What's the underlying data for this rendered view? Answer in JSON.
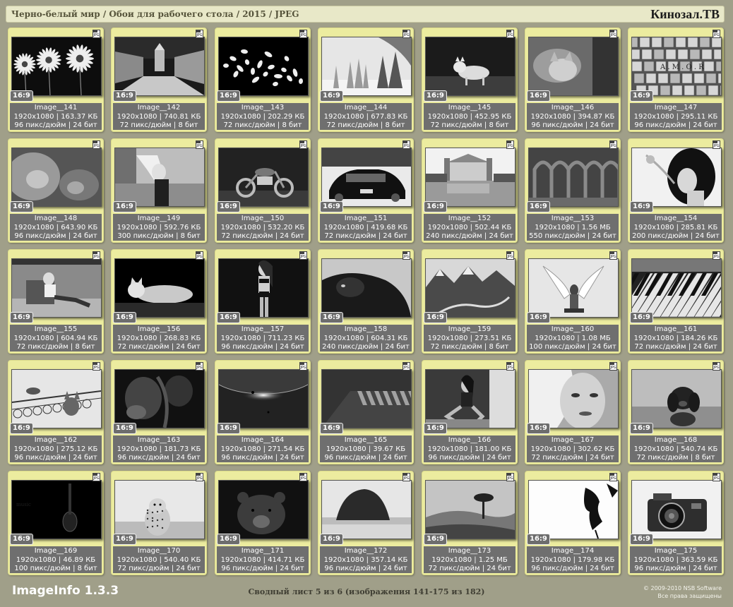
{
  "header": {
    "path": "Черно-белый мир / Обои для рабочего стола / 2015 / JPEG",
    "brand": "Кинозал.ТВ"
  },
  "icons": {
    "format_badge": "jpeg-file-icon",
    "format_text": "JPG"
  },
  "colors": {
    "background": "#a09f89",
    "card": "#ecec9f",
    "info": "#6f6f6f",
    "header": "#e8e8c8"
  },
  "images": [
    {
      "name": "Image__141",
      "res": "1920x1080 | 163.37 КБ",
      "meta": "96 пикс/дюйм | 24 бит",
      "ratio": "16:9",
      "subject": "daisies"
    },
    {
      "name": "Image__142",
      "res": "1920x1080 | 740.81 КБ",
      "meta": "72 пикс/дюйм | 8 бит",
      "ratio": "16:9",
      "subject": "palace-street"
    },
    {
      "name": "Image__143",
      "res": "1920x1080 | 202.29 КБ",
      "meta": "72 пикс/дюйм | 8 бит",
      "ratio": "16:9",
      "subject": "falling-discs"
    },
    {
      "name": "Image__144",
      "res": "1920x1080 | 677.83 КБ",
      "meta": "72 пикс/дюйм | 8 бит",
      "ratio": "16:9",
      "subject": "snowy-forest"
    },
    {
      "name": "Image__145",
      "res": "1920x1080 | 452.95 КБ",
      "meta": "72 пикс/дюйм | 8 бит",
      "ratio": "16:9",
      "subject": "wolf"
    },
    {
      "name": "Image__146",
      "res": "1920x1080 | 394.87 КБ",
      "meta": "96 пикс/дюйм | 24 бит",
      "ratio": "16:9",
      "subject": "kitten"
    },
    {
      "name": "Image__147",
      "res": "1920x1080 | 295.11 КБ",
      "meta": "96 пикс/дюйм | 24 бит",
      "ratio": "16:9",
      "subject": "letter-tiles"
    },
    {
      "name": "Image__148",
      "res": "1920x1080 | 643.90 КБ",
      "meta": "96 пикс/дюйм | 24 бит",
      "ratio": "16:9",
      "subject": "lions"
    },
    {
      "name": "Image__149",
      "res": "1920x1080 | 592.76 КБ",
      "meta": "300 пикс/дюйм | 8 бит",
      "ratio": "16:9",
      "subject": "blonde-girl"
    },
    {
      "name": "Image__150",
      "res": "1920x1080 | 532.20 КБ",
      "meta": "72 пикс/дюйм | 24 бит",
      "ratio": "16:9",
      "subject": "motorcycle"
    },
    {
      "name": "Image__151",
      "res": "1920x1080 | 419.68 КБ",
      "meta": "72 пикс/дюйм | 24 бит",
      "ratio": "16:9",
      "subject": "sports-car"
    },
    {
      "name": "Image__152",
      "res": "1920x1080 | 502.44 КБ",
      "meta": "240 пикс/дюйм | 24 бит",
      "ratio": "16:9",
      "subject": "castle-lake"
    },
    {
      "name": "Image__153",
      "res": "1920x1080 | 1.56 МБ",
      "meta": "550 пикс/дюйм | 24 бит",
      "ratio": "16:9",
      "subject": "ruins"
    },
    {
      "name": "Image__154",
      "res": "1920x1080 | 285.81 КБ",
      "meta": "200 пикс/дюйм | 24 бит",
      "ratio": "16:9",
      "subject": "smoking-woman"
    },
    {
      "name": "Image__155",
      "res": "1920x1080 | 604.94 КБ",
      "meta": "72 пикс/дюйм | 8 бит",
      "ratio": "16:9",
      "subject": "man-chair"
    },
    {
      "name": "Image__156",
      "res": "1920x1080 | 268.83 КБ",
      "meta": "72 пикс/дюйм | 24 бит",
      "ratio": "16:9",
      "subject": "lying-cat"
    },
    {
      "name": "Image__157",
      "res": "1920x1080 | 711.23 КБ",
      "meta": "96 пикс/дюйм | 24 бит",
      "ratio": "16:9",
      "subject": "woman-standing"
    },
    {
      "name": "Image__158",
      "res": "1920x1080 | 604.31 КБ",
      "meta": "240 пикс/дюйм | 24 бит",
      "ratio": "16:9",
      "subject": "horse"
    },
    {
      "name": "Image__159",
      "res": "1920x1080 | 273.51 КБ",
      "meta": "72 пикс/дюйм | 8 бит",
      "ratio": "16:9",
      "subject": "mountain-river"
    },
    {
      "name": "Image__160",
      "res": "1920x1080 | 1.08 МБ",
      "meta": "100 пикс/дюйм | 24 бит",
      "ratio": "16:9",
      "subject": "winged-figure"
    },
    {
      "name": "Image__161",
      "res": "1920x1080 | 184.26 КБ",
      "meta": "72 пикс/дюйм | 24 бит",
      "ratio": "16:9",
      "subject": "piano-keys"
    },
    {
      "name": "Image__162",
      "res": "1920x1080 | 275.12 КБ",
      "meta": "96 пикс/дюйм | 24 бит",
      "ratio": "16:9",
      "subject": "cats-railing"
    },
    {
      "name": "Image__163",
      "res": "1920x1080 | 181.73 КБ",
      "meta": "96 пикс/дюйм | 24 бит",
      "ratio": "16:9",
      "subject": "dark-figures"
    },
    {
      "name": "Image__164",
      "res": "1920x1080 | 271.54 КБ",
      "meta": "96 пикс/дюйм | 24 бит",
      "ratio": "16:9",
      "subject": "planet-glow"
    },
    {
      "name": "Image__165",
      "res": "1920x1080 | 39.67 КБ",
      "meta": "96 пикс/дюйм | 24 бит",
      "ratio": "16:9",
      "subject": "keys-closeup"
    },
    {
      "name": "Image__166",
      "res": "1920x1080 | 181.00 КБ",
      "meta": "96 пикс/дюйм | 24 бит",
      "ratio": "16:9",
      "subject": "woman-sitting"
    },
    {
      "name": "Image__167",
      "res": "1920x1080 | 302.62 КБ",
      "meta": "72 пикс/дюйм | 24 бит",
      "ratio": "16:9",
      "subject": "face-portrait"
    },
    {
      "name": "Image__168",
      "res": "1920x1080 | 540.74 КБ",
      "meta": "72 пикс/дюйм | 8 бит",
      "ratio": "16:9",
      "subject": "puppy"
    },
    {
      "name": "Image__169",
      "res": "1920x1080 | 46.89 КБ",
      "meta": "100 пикс/дюйм | 8 бит",
      "ratio": "16:9",
      "subject": "violin"
    },
    {
      "name": "Image__170",
      "res": "1920x1080 | 540.40 КБ",
      "meta": "72 пикс/дюйм | 24 бит",
      "ratio": "16:9",
      "subject": "cheetah"
    },
    {
      "name": "Image__171",
      "res": "1920x1080 | 414.71 КБ",
      "meta": "96 пикс/дюйм | 24 бит",
      "ratio": "16:9",
      "subject": "bear"
    },
    {
      "name": "Image__172",
      "res": "1920x1080 | 357.14 КБ",
      "meta": "96 пикс/дюйм | 24 бит",
      "ratio": "16:9",
      "subject": "sea-rock"
    },
    {
      "name": "Image__173",
      "res": "1920x1080 | 1.25 МБ",
      "meta": "72 пикс/дюйм | 24 бит",
      "ratio": "16:9",
      "subject": "lone-tree"
    },
    {
      "name": "Image__174",
      "res": "1920x1080 | 179.98 КБ",
      "meta": "96 пикс/дюйм | 24 бит",
      "ratio": "16:9",
      "subject": "ink-sketch"
    },
    {
      "name": "Image__175",
      "res": "1920x1080 | 363.59 КБ",
      "meta": "96 пикс/дюйм | 24 бит",
      "ratio": "16:9",
      "subject": "camera"
    }
  ],
  "footer": {
    "logo": "ImageInfo 1.3.3",
    "summary": "Сводный лист 5 из 6 (изображения 141-175 из 182)",
    "copyright": "© 2009-2010 NSB Software",
    "rights": "Все права защищены"
  }
}
